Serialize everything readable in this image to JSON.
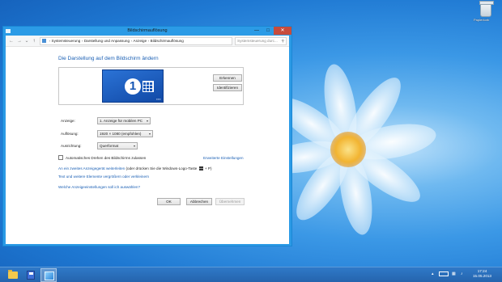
{
  "window": {
    "title": "Bildschirmauflösung",
    "min_glyph": "—",
    "max_glyph": "□",
    "close_glyph": "✕"
  },
  "nav": {
    "back": "←",
    "forward": "→",
    "recent": "⌄",
    "up": "↑",
    "breadcrumb": [
      "Systemsteuerung",
      "Darstellung und Anpassung",
      "Anzeige",
      "Bildschirmauflösung"
    ],
    "separator": "›",
    "refresh": "⟳",
    "search_placeholder": "Systemsteuerung durc...",
    "search_icon": "⚲"
  },
  "main": {
    "heading": "Die Darstellung auf dem Bildschirm ändern",
    "monitor_number": "1",
    "monitor_dots": "▪▪▪",
    "detect_label": "Erkennen",
    "identify_label": "Identifizieren",
    "display_label": "Anzeige:",
    "display_value": "1. Anzeige für mobilen PC",
    "resolution_label": "Auflösung:",
    "resolution_value": "1920 × 1080 (empfohlen)",
    "orientation_label": "Ausrichtung:",
    "orientation_value": "Querformat",
    "auto_rotate_label": "Automatisches Drehen des Bildschirms zulassen",
    "advanced_link": "Erweiterte Einstellungen",
    "project_link": "An ein zweites Anzeigegerät weiterleiten",
    "project_hint_pre": "(oder drücken Sie die Windows-Logo-Taste",
    "project_hint_post": "+ P)",
    "text_size_link": "Text und weitere Elemente vergrößern oder verkleinern",
    "which_settings_link": "Welche Anzeigeeinstellungen soll ich auswählen?"
  },
  "footer": {
    "ok": "OK",
    "cancel": "Abbrechen",
    "apply": "Übernehmen"
  },
  "desktop": {
    "recycle_bin": "Papierkorb"
  },
  "taskbar": {
    "time": "17:24",
    "date": "15.05.2013",
    "tray_arrow": "▴"
  },
  "colors": {
    "accent": "#2b9be6",
    "link": "#1a5fb4",
    "close": "#c74b3c"
  }
}
